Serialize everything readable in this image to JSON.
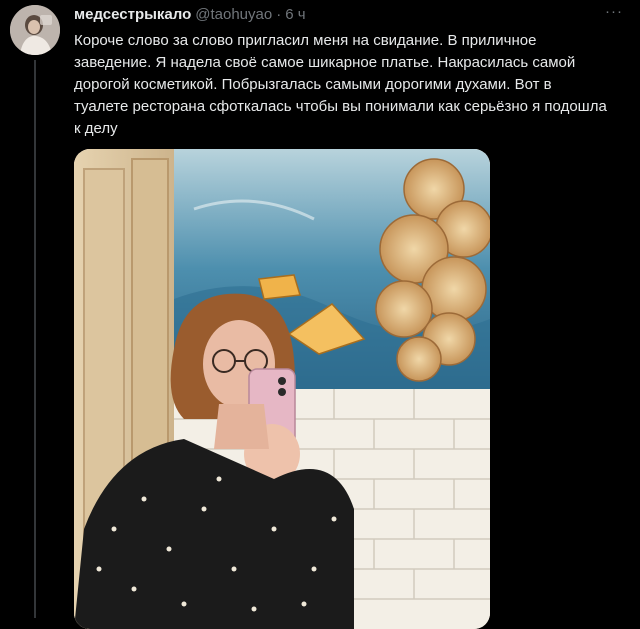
{
  "tweet": {
    "display_name": "медсестрыкало",
    "handle": "@taohuyao",
    "separator": "·",
    "timestamp": "6 ч",
    "more_glyph": "···",
    "text": "Короче слово за слово пригласил меня на свидание. В приличное заведение. Я надела своё самое шикарное платье. Накрасилась самой дорогой косметикой. Побрызгалась самыми дорогими духами. Вот в туалете ресторана сфоткалась чтобы вы понимали как серьёзно я подошла к делу"
  },
  "icons": {
    "more": "more-horizontal-icon",
    "avatar": "user-avatar"
  },
  "colors": {
    "background": "#000000",
    "primary_text": "#e7e9ea",
    "secondary_text": "#71767b",
    "thread_line": "#333639"
  }
}
